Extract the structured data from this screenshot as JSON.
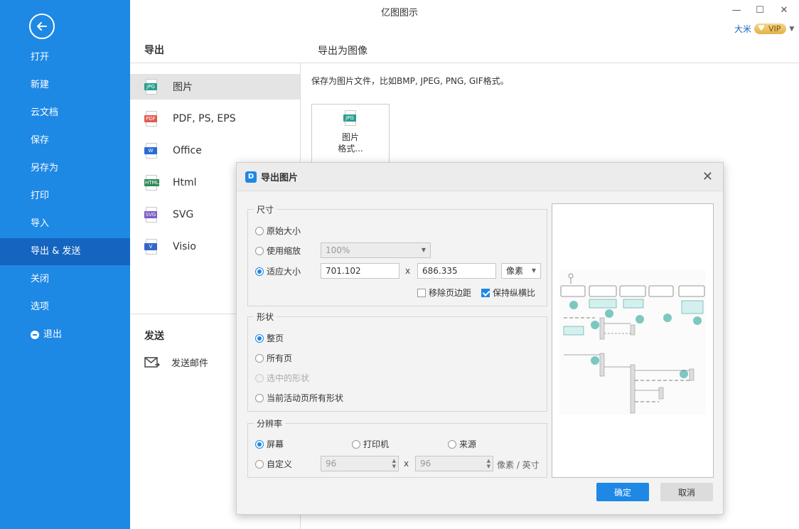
{
  "app": {
    "title": "亿图图示"
  },
  "window": {
    "minimize": "—",
    "maximize": "☐",
    "close": "✕"
  },
  "user": {
    "name": "大米",
    "vip": "VIP"
  },
  "sidebar": {
    "items": [
      {
        "label": "打开"
      },
      {
        "label": "新建"
      },
      {
        "label": "云文档"
      },
      {
        "label": "保存"
      },
      {
        "label": "另存为"
      },
      {
        "label": "打印"
      },
      {
        "label": "导入"
      },
      {
        "label": "导出 & 发送"
      },
      {
        "label": "关闭"
      },
      {
        "label": "选项"
      },
      {
        "label": "退出"
      }
    ]
  },
  "export": {
    "title": "导出",
    "items": [
      {
        "label": "图片",
        "tag": "JPG",
        "color": "#2a9d8f"
      },
      {
        "label": "PDF, PS, EPS",
        "tag": "PDF",
        "color": "#e05a4f"
      },
      {
        "label": "Office",
        "tag": "W",
        "color": "#2b6cd4"
      },
      {
        "label": "Html",
        "tag": "HTML",
        "color": "#2e8b57"
      },
      {
        "label": "SVG",
        "tag": "SVG",
        "color": "#7b5cc4"
      },
      {
        "label": "Visio",
        "tag": "V",
        "color": "#3566c8"
      }
    ]
  },
  "send": {
    "title": "发送",
    "mail": "发送邮件"
  },
  "right": {
    "title": "导出为图像",
    "desc": "保存为图片文件，比如BMP, JPEG, PNG, GIF格式。",
    "card_tag": "JPG",
    "card_line1": "图片",
    "card_line2": "格式..."
  },
  "dialog": {
    "title": "导出图片",
    "logo": "D",
    "close": "✕",
    "size": {
      "title": "尺寸",
      "original": "原始大小",
      "scale": "使用缩放",
      "scale_value": "100%",
      "fit": "适应大小",
      "width": "701.102",
      "height": "686.335",
      "x": "x",
      "unit": "像素",
      "remove_margin": "移除页边距",
      "keep_ratio": "保持纵横比"
    },
    "shape": {
      "title": "形状",
      "whole_page": "整页",
      "all_pages": "所有页",
      "selected": "选中的形状",
      "current_all": "当前活动页所有形状"
    },
    "resolution": {
      "title": "分辨率",
      "screen": "屏幕",
      "printer": "打印机",
      "source": "来源",
      "custom": "自定义",
      "dpi_x": "96",
      "dpi_y": "96",
      "x": "x",
      "unit": "像素 / 英寸"
    },
    "ok": "确定",
    "cancel": "取消"
  }
}
